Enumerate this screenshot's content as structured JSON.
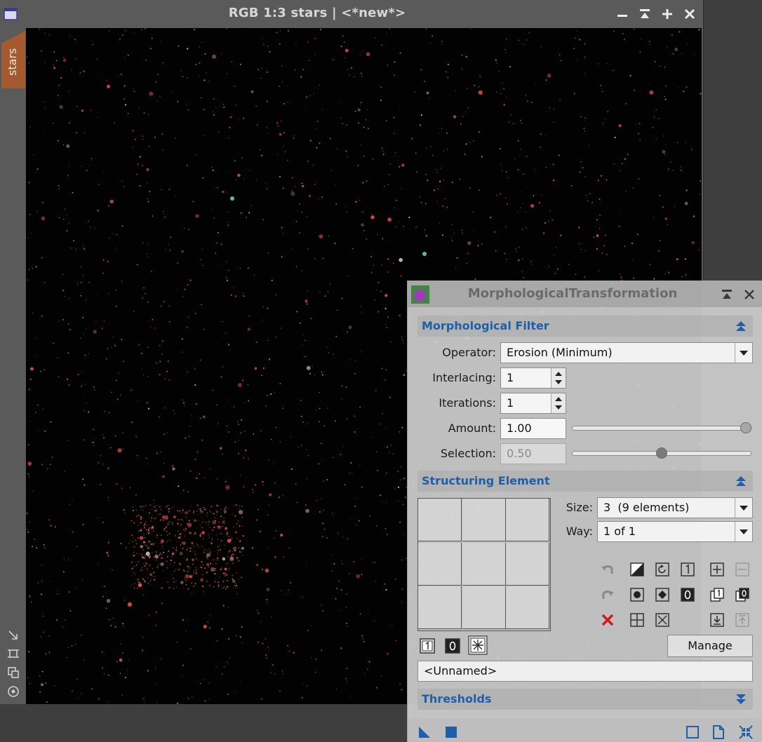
{
  "image_window": {
    "title": "RGB 1:3 stars | <*new*>",
    "tab_label": "stars",
    "controls": [
      "minimize-icon",
      "shade-icon",
      "maximize-icon",
      "close-icon"
    ],
    "side_icons": [
      "zoom-to-fit-icon",
      "crop-icon",
      "clone-icon",
      "target-icon"
    ],
    "background_color": "#020202",
    "star_color": "#e0504a"
  },
  "process": {
    "title": "MorphologicalTransformation",
    "morph_filter": {
      "section_title": "Morphological Filter",
      "operator_label": "Operator:",
      "operator_value": "Erosion (Minimum)",
      "interlacing_label": "Interlacing:",
      "interlacing_value": "1",
      "iterations_label": "Iterations:",
      "iterations_value": "1",
      "amount_label": "Amount:",
      "amount_value": "1.00",
      "amount_level": 1.0,
      "selection_label": "Selection:",
      "selection_value": "0.50",
      "selection_level": 0.5
    },
    "structuring": {
      "section_title": "Structuring Element",
      "size_label": "Size:",
      "size_value": "3  (9 elements)",
      "way_label": "Way:",
      "way_value": "1 of 1",
      "manage_label": "Manage",
      "name_value": "<Unnamed>",
      "grid_cells": 9
    },
    "thresholds": {
      "section_title": "Thresholds"
    },
    "accent_color": "#1f5ea8"
  }
}
